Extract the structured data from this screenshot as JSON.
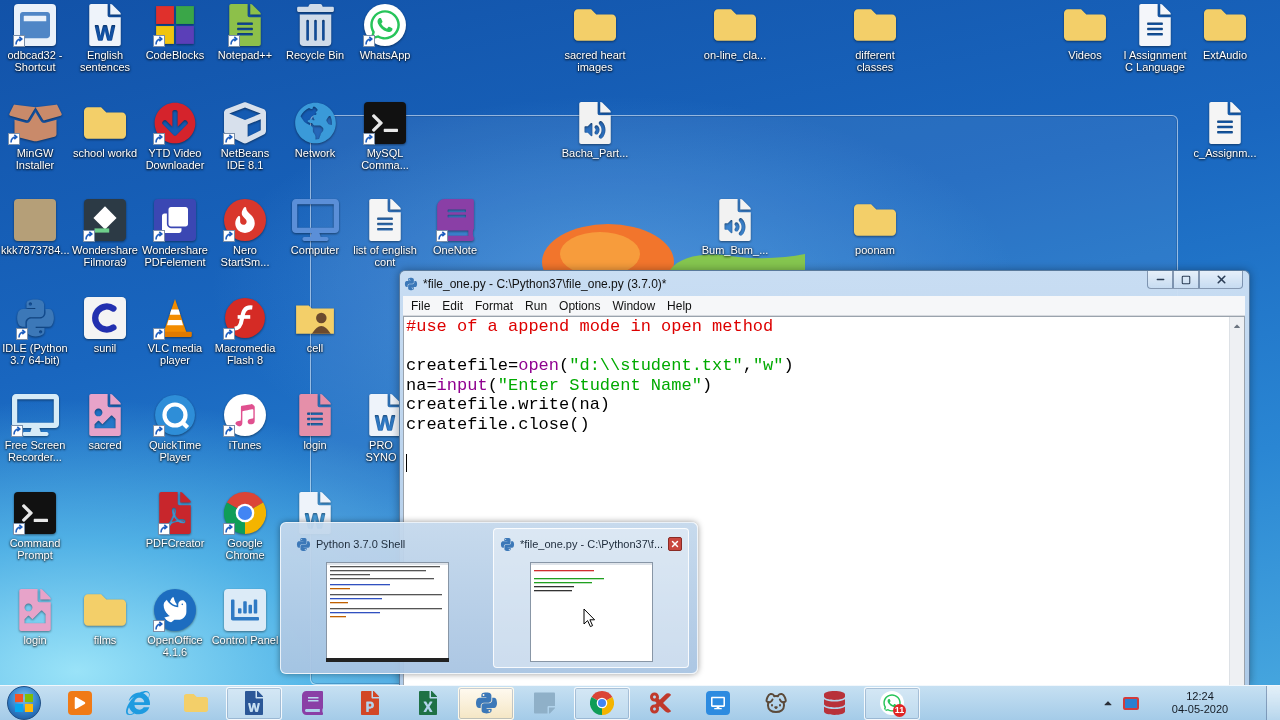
{
  "desktop": {
    "icons": [
      {
        "label": "odbcad32 - Shortcut",
        "kind": "program",
        "shortcut": true
      },
      {
        "label": "English sentences",
        "kind": "word",
        "shortcut": false
      },
      {
        "label": "CodeBlocks",
        "kind": "blocks",
        "shortcut": true
      },
      {
        "label": "Notepad++",
        "kind": "notepad",
        "shortcut": true
      },
      {
        "label": "Recycle Bin",
        "kind": "bin",
        "shortcut": false
      },
      {
        "label": "WhatsApp",
        "kind": "chat",
        "shortcut": true
      },
      {
        "label": "sacred heart images",
        "kind": "folder",
        "shortcut": false
      },
      {
        "label": "on-line_cla...",
        "kind": "folder",
        "shortcut": false
      },
      {
        "label": "different classes",
        "kind": "folder",
        "shortcut": false
      },
      {
        "label": "Videos",
        "kind": "folder",
        "shortcut": false
      },
      {
        "label": "I Assignment C Language",
        "kind": "doc",
        "shortcut": false
      },
      {
        "label": "ExtAudio",
        "kind": "folder",
        "shortcut": false
      },
      {
        "label": "MinGW Installer",
        "kind": "installer",
        "shortcut": true
      },
      {
        "label": "school workd",
        "kind": "folder",
        "shortcut": false
      },
      {
        "label": "YTD Video Downloader",
        "kind": "download",
        "shortcut": true
      },
      {
        "label": "NetBeans IDE 8.1",
        "kind": "cube",
        "shortcut": true
      },
      {
        "label": "Network",
        "kind": "globe",
        "shortcut": false
      },
      {
        "label": "MySQL Comma...",
        "kind": "console",
        "shortcut": true
      },
      {
        "label": "Bacha_Part...",
        "kind": "audio",
        "shortcut": false
      },
      {
        "label": "c_Assignm...",
        "kind": "text",
        "shortcut": false
      },
      {
        "label": "kkk7873784...",
        "kind": "photo",
        "shortcut": false
      },
      {
        "label": "Wondershare Filmora9",
        "kind": "filmora",
        "shortcut": true
      },
      {
        "label": "Wondershare PDFelement",
        "kind": "pdfelement",
        "shortcut": true
      },
      {
        "label": "Nero StartSm...",
        "kind": "nero",
        "shortcut": true
      },
      {
        "label": "Computer",
        "kind": "computer",
        "shortcut": false
      },
      {
        "label": "list of english cont",
        "kind": "text",
        "shortcut": false
      },
      {
        "label": "OneNote",
        "kind": "onenote",
        "shortcut": true
      },
      {
        "label": "Bum_Bum_...",
        "kind": "audio",
        "shortcut": false
      },
      {
        "label": "poonam",
        "kind": "folder",
        "shortcut": false
      },
      {
        "label": "IDLE (Python 3.7 64-bit)",
        "kind": "python",
        "shortcut": true
      },
      {
        "label": "sunil",
        "kind": "c-app",
        "shortcut": false
      },
      {
        "label": "VLC media player",
        "kind": "cone",
        "shortcut": true
      },
      {
        "label": "Macromedia Flash 8",
        "kind": "flash",
        "shortcut": true
      },
      {
        "label": "cell",
        "kind": "user-folder",
        "shortcut": false
      },
      {
        "label": "Free Screen Recorder...",
        "kind": "recorder",
        "shortcut": true
      },
      {
        "label": "sacred",
        "kind": "image-doc",
        "shortcut": false
      },
      {
        "label": "QuickTime Player",
        "kind": "quicktime",
        "shortcut": true
      },
      {
        "label": "iTunes",
        "kind": "itunes",
        "shortcut": true
      },
      {
        "label": "login",
        "kind": "access-doc",
        "shortcut": false
      },
      {
        "label": "PRO SYNO",
        "kind": "word",
        "shortcut": false
      },
      {
        "label": "Command Prompt",
        "kind": "console",
        "shortcut": true
      },
      {
        "label": "PDFCreator",
        "kind": "pdfcreator",
        "shortcut": true
      },
      {
        "label": "Google Chrome",
        "kind": "chrome",
        "shortcut": true
      },
      {
        "kind": "word",
        "shortcut": false
      },
      {
        "label": "login",
        "kind": "image-doc",
        "shortcut": false
      },
      {
        "label": "films",
        "kind": "folder",
        "shortcut": false
      },
      {
        "label": "OpenOffice 4.1.6",
        "kind": "openoffice",
        "shortcut": true
      },
      {
        "label": "Control Panel",
        "kind": "control-panel",
        "shortcut": false
      }
    ]
  },
  "editor": {
    "title": "*file_one.py - C:\\Python37\\file_one.py (3.7.0)*",
    "menu": [
      "File",
      "Edit",
      "Format",
      "Run",
      "Options",
      "Window",
      "Help"
    ],
    "lines": [
      {
        "tokens": [
          {
            "kind": "comment",
            "text": "#use of a append mode in open method"
          }
        ],
        "cursor": false
      },
      {
        "cursor": false
      },
      {
        "tokens": [
          {
            "kind": "plain",
            "text": "createfile="
          },
          {
            "kind": "builtin",
            "text": "open"
          },
          {
            "kind": "plain",
            "text": "("
          },
          {
            "kind": "string",
            "text": "\"d:\\\\student.txt\""
          },
          {
            "kind": "plain",
            "text": ","
          },
          {
            "kind": "string",
            "text": "\"w\""
          },
          {
            "kind": "plain",
            "text": ")"
          }
        ],
        "cursor": false
      },
      {
        "tokens": [
          {
            "kind": "plain",
            "text": "na="
          },
          {
            "kind": "builtin",
            "text": "input"
          },
          {
            "kind": "plain",
            "text": "("
          },
          {
            "kind": "string",
            "text": "\"Enter Student Name\""
          },
          {
            "kind": "plain",
            "text": ")"
          }
        ],
        "cursor": false
      },
      {
        "tokens": [
          {
            "kind": "plain",
            "text": "createfile.write(na)"
          }
        ],
        "cursor": false
      },
      {
        "tokens": [
          {
            "kind": "plain",
            "text": "createfile.close()"
          }
        ],
        "cursor": false
      },
      {
        "cursor": false
      },
      {
        "cursor": true
      }
    ]
  },
  "taskbar_preview": {
    "thumbnails": [
      {
        "title": "Python 3.7.0 Shell",
        "kind": "shell",
        "selected": false
      },
      {
        "title": "*file_one.py - C:\\Python37\\f...",
        "kind": "editor",
        "selected": true
      }
    ]
  },
  "taskbar": {
    "apps": [
      {
        "kind": "media",
        "running": false,
        "hover": false
      },
      {
        "kind": "ie",
        "running": false,
        "hover": false
      },
      {
        "kind": "folder",
        "running": false,
        "hover": false
      },
      {
        "kind": "word-app",
        "running": true,
        "hover": false
      },
      {
        "kind": "onenote",
        "running": false,
        "hover": false
      },
      {
        "kind": "powerpoint",
        "running": false,
        "hover": false
      },
      {
        "kind": "excel",
        "running": false,
        "hover": false
      },
      {
        "kind": "python",
        "running": true,
        "hover": true
      },
      {
        "kind": "notes",
        "running": false,
        "hover": false
      },
      {
        "kind": "chrome",
        "running": true,
        "hover": false
      },
      {
        "kind": "snip",
        "running": false,
        "hover": false
      },
      {
        "kind": "screen",
        "running": false,
        "hover": false
      },
      {
        "kind": "gimp",
        "running": false,
        "hover": false
      },
      {
        "kind": "access",
        "running": false,
        "hover": false
      },
      {
        "kind": "chat",
        "running": true,
        "hover": false,
        "badge": "11"
      }
    ],
    "clock": {
      "time": "12:24",
      "date": "04-05-2020"
    }
  }
}
